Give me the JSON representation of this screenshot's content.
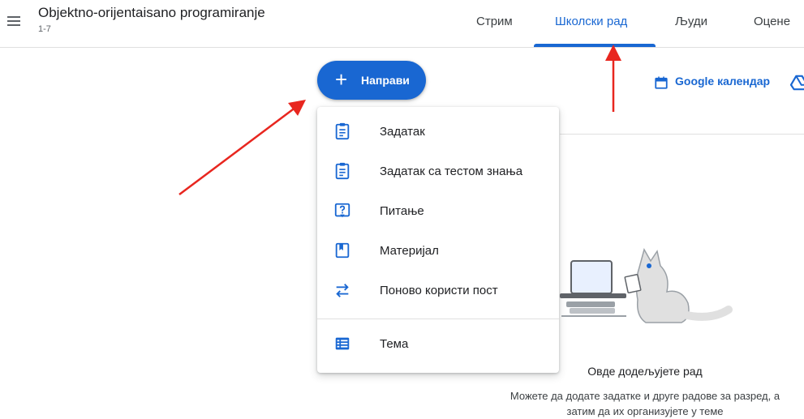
{
  "header": {
    "class_title": "Objektno-orijentaisano programiranje",
    "class_section": "1-7",
    "tabs": [
      {
        "label": "Стрим"
      },
      {
        "label": "Школски рад"
      },
      {
        "label": "Људи"
      },
      {
        "label": "Оцене"
      }
    ],
    "active_tab": "Школски рад"
  },
  "toolbar": {
    "create_label": "Направи",
    "calendar_label": "Google календар"
  },
  "create_menu": {
    "items": [
      {
        "label": "Задатак",
        "icon": "assignment-icon"
      },
      {
        "label": "Задатак са тестом знања",
        "icon": "quiz-assignment-icon"
      },
      {
        "label": "Питање",
        "icon": "question-icon"
      },
      {
        "label": "Материјал",
        "icon": "material-icon"
      },
      {
        "label": "Поново користи пост",
        "icon": "reuse-post-icon"
      },
      {
        "label": "Тема",
        "icon": "topic-icon"
      }
    ]
  },
  "empty_state": {
    "title": "Овде додељујете рад",
    "description": "Можете да додате задатке и друге радове за разред, а затим да их организујете у теме"
  },
  "colors": {
    "accent": "#1967d2",
    "annotation_arrow": "#e8261f"
  }
}
